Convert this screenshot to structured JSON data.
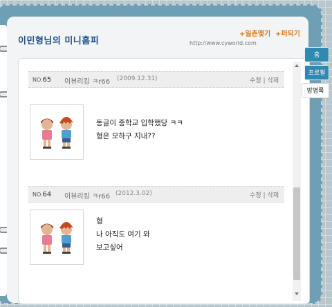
{
  "header": {
    "title": "이민형님의 미니홈피",
    "links": [
      "+일촌맺기",
      "+퍼되기"
    ],
    "url": "http://www.cyworld.com"
  },
  "tabs": [
    {
      "label": "홈",
      "active": false
    },
    {
      "label": "프로필",
      "active": false
    },
    {
      "label": "방명록",
      "active": true
    }
  ],
  "entries": [
    {
      "no_prefix": "NO.",
      "number": "65",
      "author": "이뷰리킹 ㅋr66",
      "date": "(2009.12.31)",
      "actions": "수정 | 삭제",
      "avatar": "boy-and-girl-minimi-icon",
      "lines": [
        "동글이 중학교 입학했당 ㅋㅋ",
        "형은 모하구 지내??"
      ]
    },
    {
      "no_prefix": "NO.",
      "number": "64",
      "author": "이뷰리킹 ㅋr66",
      "date": "(2012.3.02)",
      "actions": "수정 | 삭제",
      "avatar": "boy-and-girl-minimi-icon",
      "lines": [
        "형",
        "나 아직도 여기 와",
        "보고싶어"
      ]
    }
  ],
  "colors": {
    "frame": "#6f9fb4",
    "tab_active_bg": "#ffffff",
    "tab_bg": "#2f89b0",
    "title": "#1f4f8a",
    "link": "#e07a18"
  }
}
